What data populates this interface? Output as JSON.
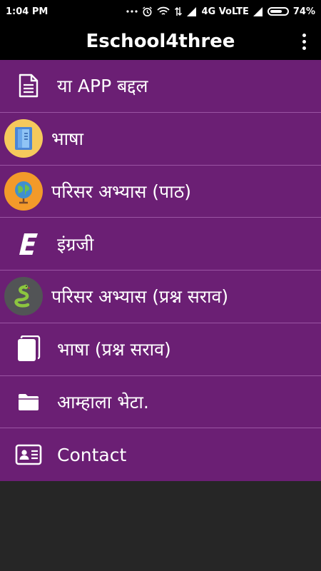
{
  "status_bar": {
    "time": "1:04 PM",
    "network": "4G VoLTE",
    "battery_percent": "74%",
    "battery_level": 0.74
  },
  "app_bar": {
    "title": "Eschool4three",
    "menu_icon": "more-vert-icon"
  },
  "menu": {
    "items": [
      {
        "label": "या APP बद्दल",
        "icon": "document-icon"
      },
      {
        "label": "भाषा",
        "icon": "book-circle-icon"
      },
      {
        "label": "परिसर अभ्यास (पाठ)",
        "icon": "globe-circle-icon"
      },
      {
        "label": "इंग्रजी",
        "icon": "letter-e-icon"
      },
      {
        "label": "परिसर अभ्यास (प्रश्न सराव)",
        "icon": "snake-circle-icon"
      },
      {
        "label": "भाषा (प्रश्न सराव)",
        "icon": "cards-icon"
      },
      {
        "label": "आम्हाला भेटा.",
        "icon": "folder-icon"
      },
      {
        "label": "Contact",
        "icon": "contact-card-icon"
      }
    ]
  },
  "colors": {
    "menu_bg": "#6b1f74",
    "divider": "#9a54a3",
    "bar_bg": "#000000",
    "background": "#262626"
  }
}
